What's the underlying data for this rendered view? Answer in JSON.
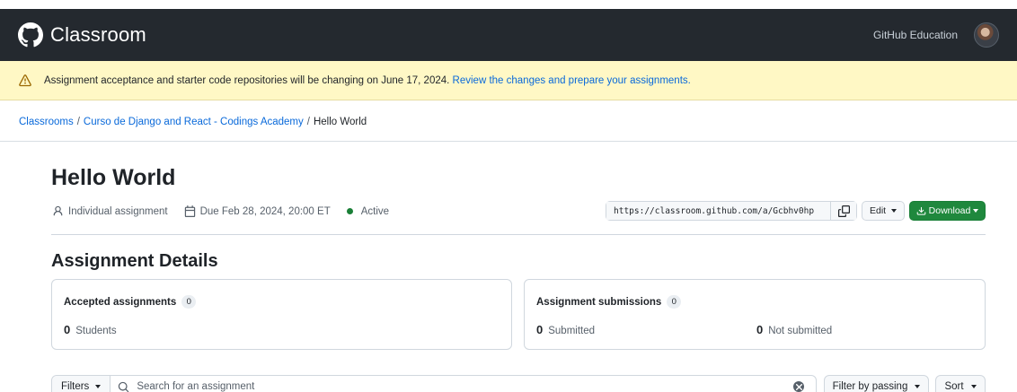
{
  "header": {
    "brand": "Classroom",
    "github_education": "GitHub Education",
    "logo_icon": "github-octocat-icon",
    "avatar": "user-avatar"
  },
  "banner": {
    "icon": "warning-icon",
    "message": "Assignment acceptance and starter code repositories will be changing on June 17, 2024.",
    "link": "Review the changes and prepare your assignments."
  },
  "breadcrumb": {
    "items": [
      "Classrooms",
      "Curso de Django and React - Codings Academy",
      "Hello World"
    ],
    "separator": "/"
  },
  "assignment": {
    "title": "Hello World",
    "type": "Individual assignment",
    "due": "Due Feb 28, 2024, 20:00 ET",
    "status": "Active",
    "status_color": "#1a7f37",
    "url": "https://classroom.github.com/a/Gcbhv0hp",
    "edit_label": "Edit",
    "download_label": "Download"
  },
  "details": {
    "title": "Assignment Details",
    "accepted": {
      "label": "Accepted assignments",
      "count": "0",
      "value": "0",
      "unit": "Students"
    },
    "submissions": {
      "label": "Assignment submissions",
      "count": "0",
      "submitted_value": "0",
      "submitted_label": "Submitted",
      "not_submitted_value": "0",
      "not_submitted_label": "Not submitted"
    }
  },
  "toolbar": {
    "filters_label": "Filters",
    "search_placeholder": "Search for an assignment",
    "filter_passing_label": "Filter by passing",
    "sort_label": "Sort"
  },
  "colors": {
    "topbar": "#24292f",
    "banner": "#fff8c5",
    "link": "#0969da",
    "primary_button": "#1f883d"
  }
}
